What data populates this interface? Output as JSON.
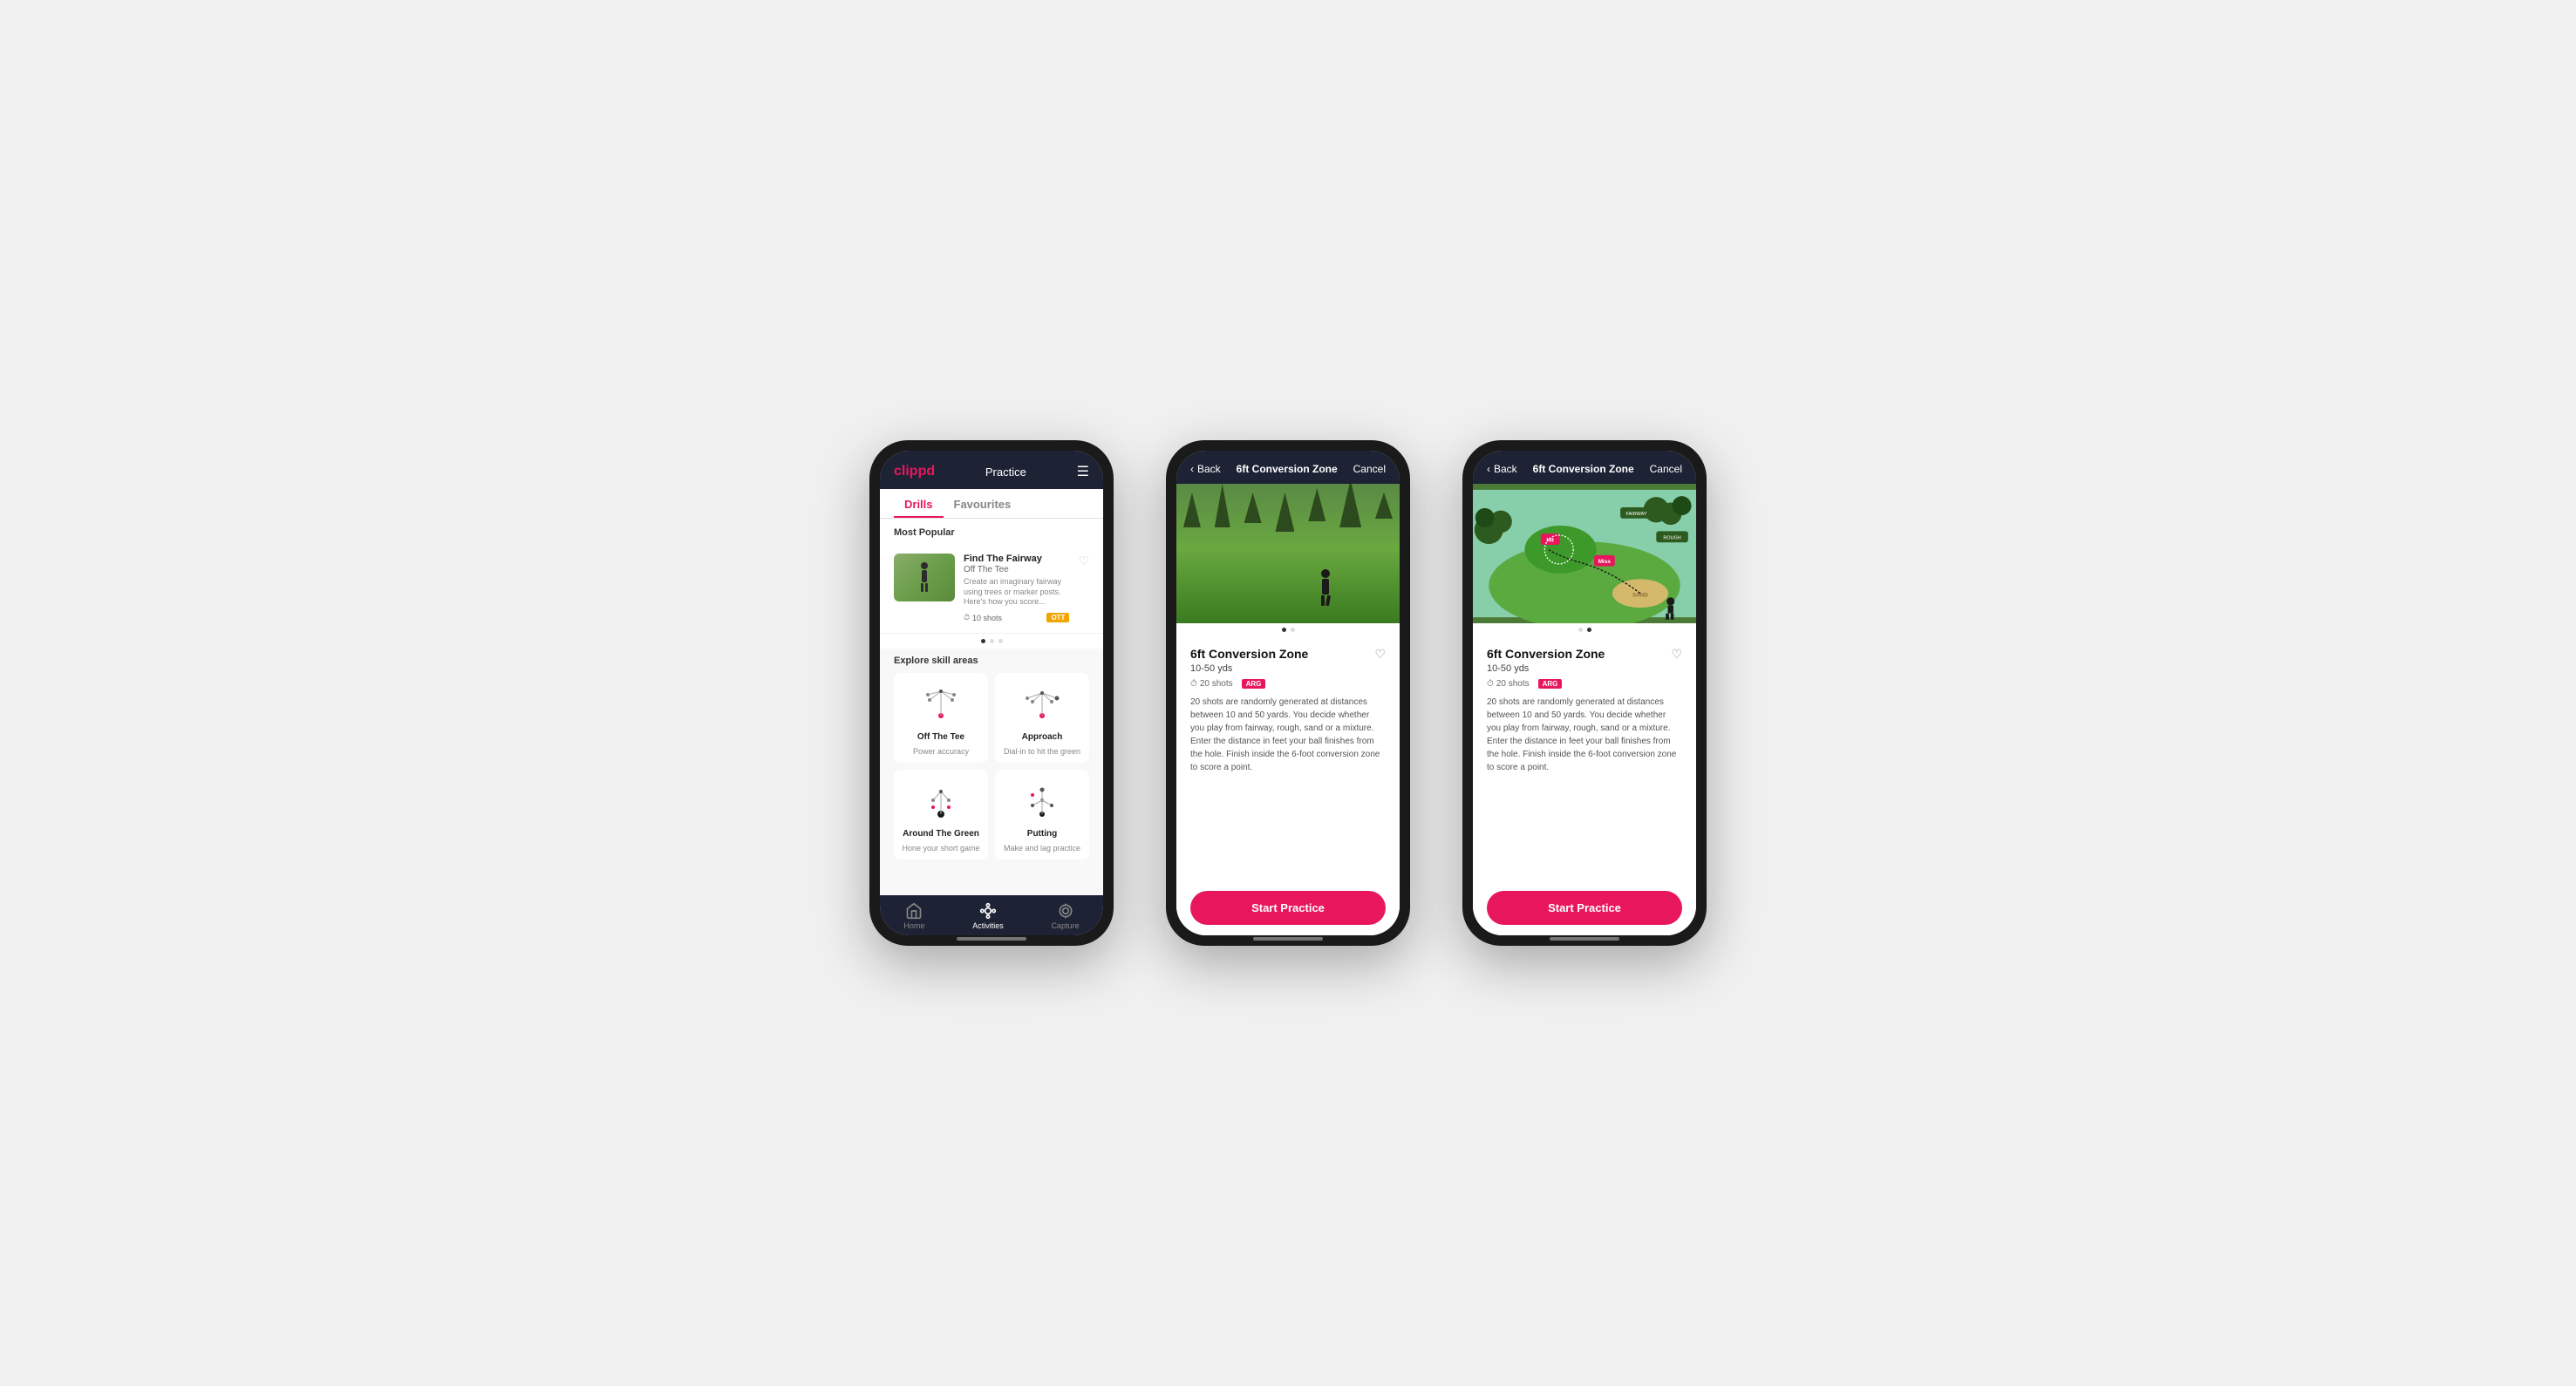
{
  "app": {
    "name": "clippd",
    "accent_color": "#e8175d",
    "dark_bg": "#1e2235"
  },
  "phone1": {
    "header": {
      "logo": "clippd",
      "title": "Practice",
      "menu_label": "menu"
    },
    "tabs": [
      {
        "label": "Drills",
        "active": true
      },
      {
        "label": "Favourites",
        "active": false
      }
    ],
    "most_popular_label": "Most Popular",
    "featured_drill": {
      "title": "Find The Fairway",
      "subtitle": "Off The Tee",
      "description": "Create an imaginary fairway using trees or marker posts. Here's how you score...",
      "shots": "10 shots",
      "tag": "OTT"
    },
    "explore_label": "Explore skill areas",
    "skill_areas": [
      {
        "name": "Off The Tee",
        "desc": "Power accuracy"
      },
      {
        "name": "Approach",
        "desc": "Dial-in to hit the green"
      },
      {
        "name": "Around The Green",
        "desc": "Hone your short game"
      },
      {
        "name": "Putting",
        "desc": "Make and lag practice"
      }
    ],
    "nav": [
      {
        "label": "Home",
        "active": false
      },
      {
        "label": "Activities",
        "active": true
      },
      {
        "label": "Capture",
        "active": false
      }
    ]
  },
  "phone2": {
    "header": {
      "back_label": "Back",
      "title": "6ft Conversion Zone",
      "cancel_label": "Cancel"
    },
    "drill": {
      "title": "6ft Conversion Zone",
      "range": "10-50 yds",
      "shots": "20 shots",
      "tag": "ARG",
      "description": "20 shots are randomly generated at distances between 10 and 50 yards. You decide whether you play from fairway, rough, sand or a mixture. Enter the distance in feet your ball finishes from the hole. Finish inside the 6-foot conversion zone to score a point.",
      "start_btn": "Start Practice"
    },
    "image_type": "photo"
  },
  "phone3": {
    "header": {
      "back_label": "Back",
      "title": "6ft Conversion Zone",
      "cancel_label": "Cancel"
    },
    "drill": {
      "title": "6ft Conversion Zone",
      "range": "10-50 yds",
      "shots": "20 shots",
      "tag": "ARG",
      "description": "20 shots are randomly generated at distances between 10 and 50 yards. You decide whether you play from fairway, rough, sand or a mixture. Enter the distance in feet your ball finishes from the hole. Finish inside the 6-foot conversion zone to score a point.",
      "start_btn": "Start Practice"
    },
    "image_type": "illustration"
  }
}
